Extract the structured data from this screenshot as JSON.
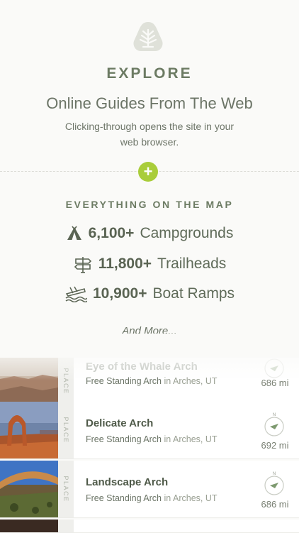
{
  "header": {
    "logo_icon": "tree-shield-icon",
    "title": "EXPLORE",
    "subtitle": "Online Guides From The Web",
    "description": "Clicking-through opens the site in your web browser."
  },
  "add_button": {
    "label": "+"
  },
  "map_section": {
    "heading": "EVERYTHING ON THE MAP",
    "stats": [
      {
        "icon": "tent-icon",
        "count": "6,100+",
        "label": "Campgrounds"
      },
      {
        "icon": "signpost-icon",
        "count": "11,800+",
        "label": "Trailheads"
      },
      {
        "icon": "boat-ramp-icon",
        "count": "10,900+",
        "label": "Boat Ramps"
      }
    ],
    "more": "And More..."
  },
  "places": [
    {
      "tag": "PLACE",
      "title": "Eye of the Whale Arch",
      "type": "Free Standing Arch",
      "in": "in Arches, UT",
      "distance": "686 mi",
      "compass_label": "N"
    },
    {
      "tag": "PLACE",
      "title": "Delicate Arch",
      "type": "Free Standing Arch",
      "in": "in Arches, UT",
      "distance": "692 mi",
      "compass_label": "N"
    },
    {
      "tag": "PLACE",
      "title": "Landscape Arch",
      "type": "Free Standing Arch",
      "in": "in Arches, UT",
      "distance": "686 mi",
      "compass_label": "N"
    }
  ],
  "colors": {
    "accent_green": "#a9cd3a",
    "text_green": "#6c7b63"
  }
}
